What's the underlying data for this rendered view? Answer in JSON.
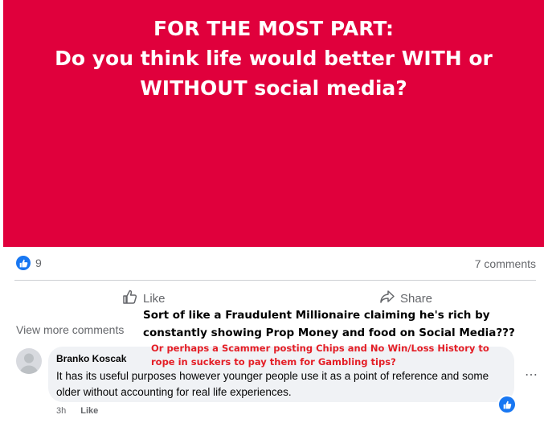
{
  "post": {
    "title_lines": [
      "FOR THE MOST PART:",
      "Do you think life would better WITH or",
      "WITHOUT social media?"
    ],
    "background_color": "#e0003c"
  },
  "reactions": {
    "count": "9",
    "icon": "like-icon"
  },
  "comments_count": "7 comments",
  "actions": {
    "like_label": "Like",
    "share_label": "Share"
  },
  "view_more": "View more comments",
  "overlay": {
    "black_lines": [
      "Sort of like a Fraudulent Millionaire claiming he's rich by",
      "constantly showing Prop Money and food on Social Media???"
    ],
    "red_lines": [
      "Or perhaps a Scammer posting Chips and No Win/Loss History to",
      "rope in suckers to pay them for Gambling tips?"
    ]
  },
  "comment": {
    "author": "Branko Koscak",
    "text": "It has its useful purposes however younger people use it as a point of reference and some older without accounting for real life experiences.",
    "time": "3h",
    "like_label": "Like"
  },
  "colors": {
    "accent": "#1877f2",
    "overlay_red": "#e41e26"
  }
}
